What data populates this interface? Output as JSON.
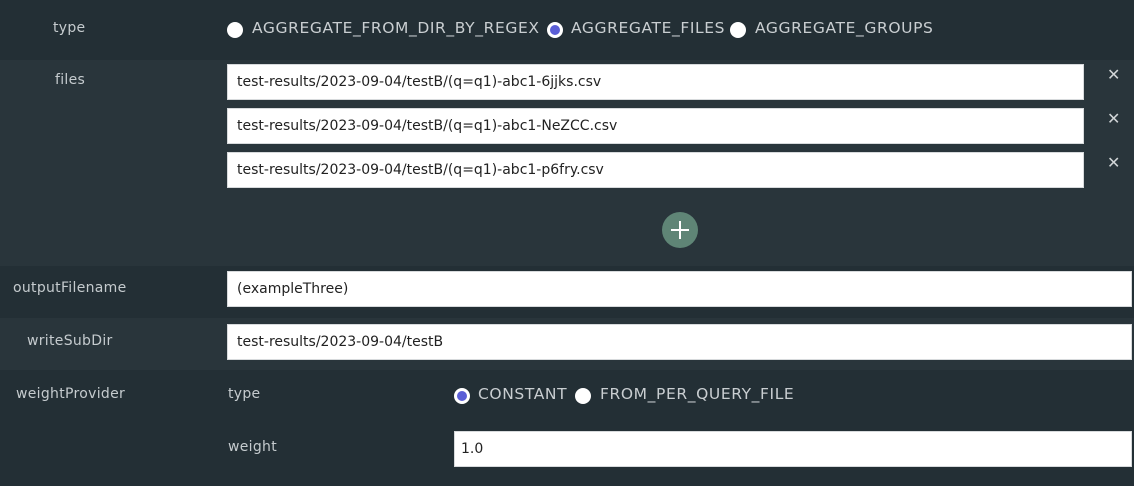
{
  "type_row": {
    "label": "type",
    "options": [
      "AGGREGATE_FROM_DIR_BY_REGEX",
      "AGGREGATE_FILES",
      "AGGREGATE_GROUPS"
    ],
    "selected": "AGGREGATE_FILES"
  },
  "files_row": {
    "label": "files",
    "values": [
      "test-results/2023-09-04/testB/(q=q1)-abc1-6jjks.csv",
      "test-results/2023-09-04/testB/(q=q1)-abc1-NeZCC.csv",
      "test-results/2023-09-04/testB/(q=q1)-abc1-p6fry.csv"
    ],
    "remove_glyph": "✕",
    "add_icon": "plus-icon"
  },
  "output_filename": {
    "label": "outputFilename",
    "value": "(exampleThree)"
  },
  "write_sub_dir": {
    "label": "writeSubDir",
    "value": "test-results/2023-09-04/testB"
  },
  "weight_provider": {
    "label": "weightProvider",
    "type_label": "type",
    "options": [
      "CONSTANT",
      "FROM_PER_QUERY_FILE"
    ],
    "selected": "CONSTANT",
    "weight_label": "weight",
    "weight_value": "1.0"
  },
  "colors": {
    "accent": "#5a5ed6",
    "add_button": "#5f8576",
    "background": "#263238"
  }
}
